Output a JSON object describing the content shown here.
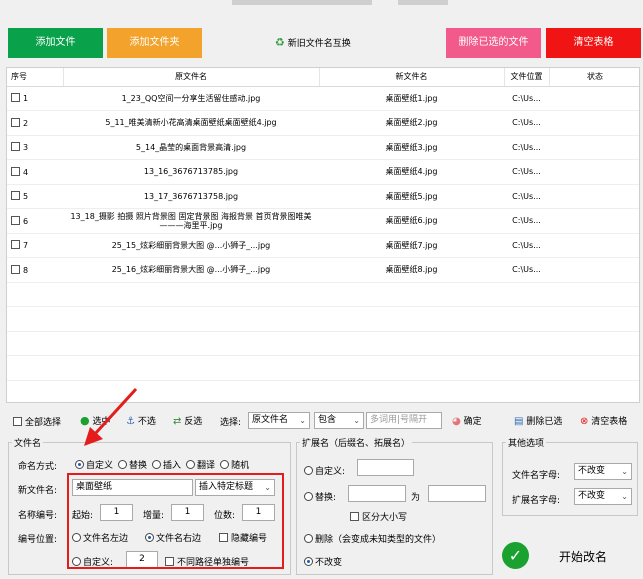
{
  "toolbar": {
    "add_file": "添加文件",
    "add_folder": "添加文件夹",
    "swap": "新旧文件名互换",
    "delete_selected": "删除已选的文件",
    "clear_table": "清空表格"
  },
  "colors": {
    "green": "#0aa14b",
    "orange": "#f3a32b",
    "pink": "#f25a8c",
    "red": "#f01414"
  },
  "table": {
    "headers": [
      "序号",
      "原文件名",
      "新文件名",
      "文件位置",
      "状态"
    ],
    "rows": [
      {
        "no": "1",
        "orig": "1_23_QQ空间一分享生活留住感动.jpg",
        "new": "桌面壁纸1.jpg",
        "loc": "C:\\Us...",
        "status": ""
      },
      {
        "no": "2",
        "orig": "5_11_唯美清新小花高清桌面壁纸桌面壁纸4.jpg",
        "new": "桌面壁纸2.jpg",
        "loc": "C:\\Us...",
        "status": ""
      },
      {
        "no": "3",
        "orig": "5_14_晶莹的桌面背景高清.jpg",
        "new": "桌面壁纸3.jpg",
        "loc": "C:\\Us...",
        "status": ""
      },
      {
        "no": "4",
        "orig": "13_16_3676713785.jpg",
        "new": "桌面壁纸4.jpg",
        "loc": "C:\\Us...",
        "status": ""
      },
      {
        "no": "5",
        "orig": "13_17_3676713758.jpg",
        "new": "桌面壁纸5.jpg",
        "loc": "C:\\Us...",
        "status": ""
      },
      {
        "no": "6",
        "orig": "13_18_摄影 拍摄 照片背景图 固定背景图 海报背景 首页背景图唯美———海里平.jpg",
        "new": "桌面壁纸6.jpg",
        "loc": "C:\\Us...",
        "status": ""
      },
      {
        "no": "7",
        "orig": "25_15_炫彩细丽背景大图 @...小狮子_...jpg",
        "new": "桌面壁纸7.jpg",
        "loc": "C:\\Us...",
        "status": ""
      },
      {
        "no": "8",
        "orig": "25_16_炫彩细丽背景大图 @...小狮子_...jpg",
        "new": "桌面壁纸8.jpg",
        "loc": "C:\\Us...",
        "status": ""
      }
    ]
  },
  "selbar": {
    "select_all": "全部选择",
    "select": "选中",
    "unselect": "不选",
    "invert": "反选",
    "choose_label": "选择:",
    "field": "原文件名",
    "mode": "包含",
    "placeholder": "多词用|号隔开",
    "confirm": "确定",
    "delete_selected": "删除已选",
    "clear_table": "清空表格"
  },
  "filename": {
    "title": "文件名",
    "naming_label": "命名方式:",
    "modes": [
      "自定义",
      "替换",
      "插入",
      "翻译",
      "随机"
    ],
    "new_name_label": "新文件名:",
    "new_name_value": "桌面壁纸",
    "insert_title": "插入特定标题",
    "numbering_label": "名称编号:",
    "start_label": "起始:",
    "start_value": "1",
    "step_label": "增量:",
    "step_value": "1",
    "digits_label": "位数:",
    "digits_value": "1",
    "position_label": "编号位置:",
    "pos_left": "文件名左边",
    "pos_right": "文件名右边",
    "hide_number": "隐藏编号",
    "custom_label": "自定义:",
    "custom_value": "2",
    "separate_path": "不同路径单独编号"
  },
  "extension": {
    "title": "扩展名（后缀名、拓展名）",
    "custom_label": "自定义:",
    "replace_label": "替换:",
    "as_label": "为",
    "case_label": "区分大小写",
    "delete_label": "删除（会变成未知类型的文件）",
    "nochange_label": "不改变"
  },
  "other": {
    "title": "其他选项",
    "filename_case_label": "文件名字母:",
    "filename_case_value": "不改变",
    "ext_case_label": "扩展名字母:",
    "ext_case_value": "不改变",
    "start_button": "开始改名"
  }
}
